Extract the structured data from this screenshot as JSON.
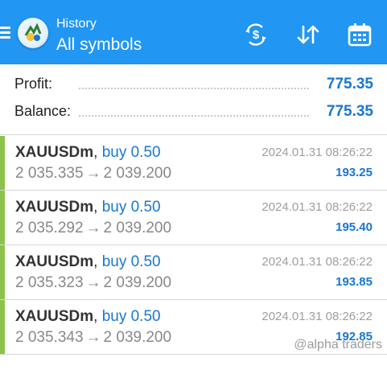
{
  "header": {
    "subtitle": "History",
    "title": "All symbols",
    "icons": [
      "menu-icon",
      "app-logo",
      "currency-exchange-icon",
      "sort-icon",
      "calendar-icon"
    ]
  },
  "summary": {
    "profit_label": "Profit:",
    "profit_value": "775.35",
    "balance_label": "Balance:",
    "balance_value": "775.35"
  },
  "deals": [
    {
      "symbol": "XAUUSDm",
      "separator": ",",
      "side": "buy 0.50",
      "open_price": "2 035.335",
      "arrow": "→",
      "close_price": "2 039.200",
      "time": "2024.01.31 08:26:22",
      "profit": "193.25"
    },
    {
      "symbol": "XAUUSDm",
      "separator": ",",
      "side": "buy 0.50",
      "open_price": "2 035.292",
      "arrow": "→",
      "close_price": "2 039.200",
      "time": "2024.01.31 08:26:22",
      "profit": "195.40"
    },
    {
      "symbol": "XAUUSDm",
      "separator": ",",
      "side": "buy 0.50",
      "open_price": "2 035.323",
      "arrow": "→",
      "close_price": "2 039.200",
      "time": "2024.01.31 08:26:22",
      "profit": "193.85"
    },
    {
      "symbol": "XAUUSDm",
      "separator": ",",
      "side": "buy 0.50",
      "open_price": "2 035.343",
      "arrow": "→",
      "close_price": "2 039.200",
      "time": "2024.01.31 08:26:22",
      "profit": "192.85"
    }
  ],
  "watermark": "@alpha traders",
  "colors": {
    "header_bg": "#2196f3",
    "accent_blue": "#1976d2",
    "buy_bar": "#8bc34a",
    "price_gray": "#888888"
  }
}
